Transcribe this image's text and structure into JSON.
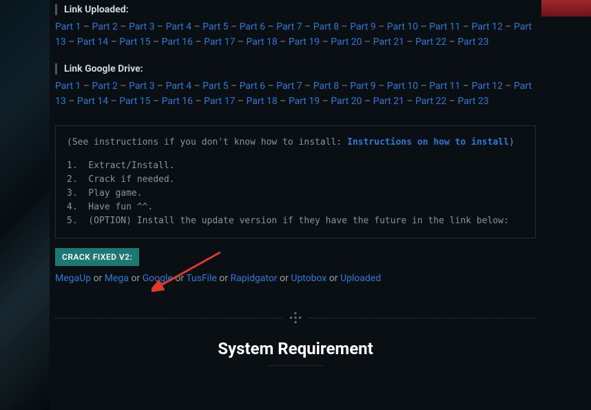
{
  "sections": {
    "uploaded": {
      "heading": "Link Uploaded:",
      "parts": 23
    },
    "gdrive": {
      "heading": "Link Google Drive:",
      "parts": 23
    }
  },
  "part_label": "Part",
  "codebox": {
    "intro_pre": "(See instructions if you don't know how to install: ",
    "intro_link": "Instructions on how to install",
    "intro_post": ")",
    "steps": [
      "Extract/Install.",
      "Crack if needed.",
      "Play game.",
      "Have fun ^^.",
      "(OPTION) Install the update version if they have the future in the link below:"
    ]
  },
  "badge": "CRACK FIXED V2:",
  "mirror": {
    "sep": " or ",
    "links": [
      "MegaUp",
      "Mega",
      "Google",
      "TusFile",
      "Rapidgator",
      "Uptobox",
      "Uploaded"
    ]
  },
  "requirement_title": "System Requirement"
}
